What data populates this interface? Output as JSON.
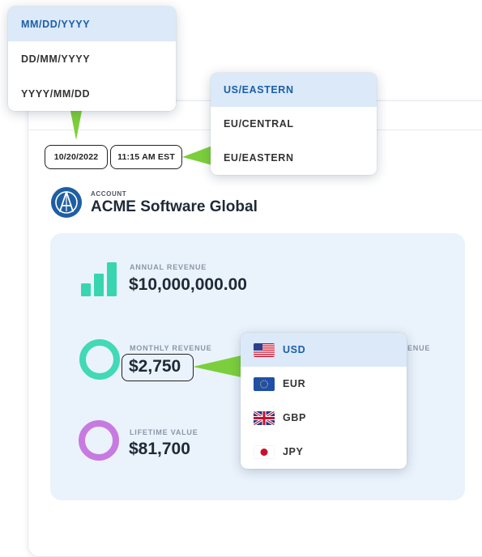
{
  "date_format_menu": {
    "options": [
      "MM/DD/YYYY",
      "DD/MM/YYYY",
      "YYYY/MM/DD"
    ],
    "selected_index": 0
  },
  "timezone_menu": {
    "options": [
      "US/EASTERN",
      "EU/CENTRAL",
      "EU/EASTERN"
    ],
    "selected_index": 0
  },
  "currency_menu": {
    "options": [
      {
        "code": "USD",
        "flag": "us-flag-icon"
      },
      {
        "code": "EUR",
        "flag": "eu-flag-icon"
      },
      {
        "code": "GBP",
        "flag": "uk-flag-icon"
      },
      {
        "code": "JPY",
        "flag": "japan-flag-icon"
      }
    ],
    "selected_index": 0
  },
  "header": {
    "date": "10/20/2022",
    "time": "11:15 AM EST"
  },
  "account": {
    "label": "ACCOUNT",
    "name": "ACME Software Global"
  },
  "metrics": {
    "annual": {
      "label": "ANNUAL REVENUE",
      "value": "$10,000,000.00"
    },
    "monthly": {
      "label": "MONTHLY REVENUE",
      "value": "$2,750"
    },
    "lifetime": {
      "label": "LIFETIME VALUE",
      "value": "$81,700"
    },
    "clipped_label": "ENUE"
  },
  "colors": {
    "accent_green": "#41d9b6",
    "accent_purple": "#c77be0",
    "selected_bg": "#dbe9f9",
    "selected_text": "#1b5fa6",
    "logo_blue": "#1e5fa3",
    "connector": "#7ccf3c"
  }
}
